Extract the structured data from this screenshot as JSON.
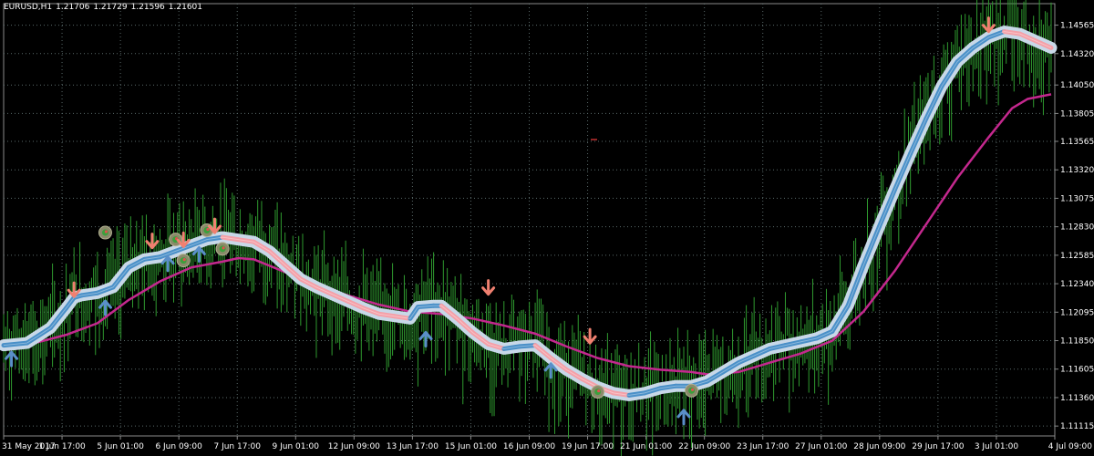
{
  "header": {
    "symbol": "EURUSD,H1",
    "open": "1.21706",
    "high": "1.21729",
    "low": "1.21596",
    "close": "1.21601"
  },
  "colors": {
    "background": "#000000",
    "grid": "#5a6a6a",
    "price_bars": "#2f9a2f",
    "slow_ma": "#c4288e",
    "band_outer": "#c8d8e8",
    "band_up": "#4a90c8",
    "band_down": "#f4a0a8",
    "arrow_up": "#5a8fc8",
    "arrow_down": "#f08070",
    "axis_text": "#ffffff"
  },
  "chart_data": {
    "type": "line",
    "title": "EURUSD,H1",
    "ylim": [
      1.1103,
      1.1475
    ],
    "y_ticks": [
      "1.14565",
      "1.14320",
      "1.14050",
      "1.13805",
      "1.13565",
      "1.13320",
      "1.13075",
      "1.12830",
      "1.12585",
      "1.12340",
      "1.12095",
      "1.11850",
      "1.11605",
      "1.11360",
      "1.11115"
    ],
    "x_ticks": [
      "31 May 2017",
      "1 Jun 17:00",
      "5 Jun 01:00",
      "6 Jun 09:00",
      "7 Jun 17:00",
      "9 Jun 01:00",
      "12 Jun 09:00",
      "13 Jun 17:00",
      "15 Jun 01:00",
      "16 Jun 09:00",
      "19 Jun 17:00",
      "21 Jun 01:00",
      "22 Jun 09:00",
      "23 Jun 17:00",
      "27 Jun 01:00",
      "28 Jun 09:00",
      "29 Jun 17:00",
      "3 Jul 01:00",
      "4 Jul 09:00"
    ],
    "grid": true,
    "series": [
      {
        "values": [
          [
            0,
            1.1181
          ],
          [
            3,
            1.1183
          ],
          [
            6,
            1.1196
          ],
          [
            8,
            1.1213
          ],
          [
            9,
            1.1222
          ],
          [
            10,
            1.1224
          ],
          [
            12,
            1.1226
          ],
          [
            14,
            1.1231
          ],
          [
            16,
            1.1248
          ],
          [
            18,
            1.1255
          ],
          [
            20,
            1.1257
          ],
          [
            22,
            1.1262
          ],
          [
            24,
            1.1267
          ],
          [
            26,
            1.1272
          ],
          [
            28,
            1.1274
          ],
          [
            30,
            1.1272
          ],
          [
            32,
            1.127
          ],
          [
            34,
            1.1262
          ],
          [
            36,
            1.125
          ],
          [
            38,
            1.1238
          ],
          [
            40,
            1.1231
          ],
          [
            42,
            1.1225
          ],
          [
            44,
            1.1219
          ],
          [
            46,
            1.1213
          ],
          [
            48,
            1.1208
          ],
          [
            50,
            1.1206
          ],
          [
            52,
            1.1204
          ],
          [
            53,
            1.1214
          ],
          [
            55,
            1.1215
          ],
          [
            56,
            1.1215
          ],
          [
            58,
            1.1204
          ],
          [
            60,
            1.1192
          ],
          [
            62,
            1.1182
          ],
          [
            64,
            1.1178
          ],
          [
            66,
            1.118
          ],
          [
            68,
            1.1181
          ],
          [
            70,
            1.117
          ],
          [
            72,
            1.116
          ],
          [
            74,
            1.1152
          ],
          [
            76,
            1.1145
          ],
          [
            78,
            1.114
          ],
          [
            80,
            1.1138
          ],
          [
            82,
            1.114
          ],
          [
            84,
            1.1144
          ],
          [
            86,
            1.1146
          ],
          [
            88,
            1.1146
          ],
          [
            90,
            1.115
          ],
          [
            92,
            1.1158
          ],
          [
            94,
            1.1166
          ],
          [
            96,
            1.1172
          ],
          [
            98,
            1.1178
          ],
          [
            100,
            1.1181
          ],
          [
            102,
            1.1184
          ],
          [
            104,
            1.1187
          ],
          [
            106,
            1.1193
          ],
          [
            108,
            1.1215
          ],
          [
            110,
            1.125
          ],
          [
            112,
            1.1283
          ],
          [
            114,
            1.1315
          ],
          [
            116,
            1.1346
          ],
          [
            118,
            1.1376
          ],
          [
            120,
            1.1404
          ],
          [
            122,
            1.1425
          ],
          [
            124,
            1.1437
          ],
          [
            126,
            1.1446
          ],
          [
            128,
            1.1451
          ],
          [
            130,
            1.1449
          ],
          [
            132,
            1.1443
          ],
          [
            134,
            1.1437
          ]
        ]
      },
      {
        "values": [
          [
            0,
            1.118
          ],
          [
            4,
            1.1183
          ],
          [
            8,
            1.119
          ],
          [
            12,
            1.12
          ],
          [
            16,
            1.122
          ],
          [
            20,
            1.1236
          ],
          [
            24,
            1.1248
          ],
          [
            28,
            1.1253
          ],
          [
            30,
            1.1256
          ],
          [
            32,
            1.1255
          ],
          [
            36,
            1.1244
          ],
          [
            40,
            1.1233
          ],
          [
            44,
            1.1224
          ],
          [
            48,
            1.1216
          ],
          [
            52,
            1.121
          ],
          [
            56,
            1.1208
          ],
          [
            60,
            1.1204
          ],
          [
            64,
            1.1198
          ],
          [
            68,
            1.1191
          ],
          [
            72,
            1.118
          ],
          [
            76,
            1.117
          ],
          [
            80,
            1.1163
          ],
          [
            84,
            1.116
          ],
          [
            88,
            1.1158
          ],
          [
            90,
            1.1156
          ],
          [
            94,
            1.1158
          ],
          [
            98,
            1.1166
          ],
          [
            102,
            1.1174
          ],
          [
            106,
            1.1185
          ],
          [
            110,
            1.121
          ],
          [
            114,
            1.1245
          ],
          [
            118,
            1.1285
          ],
          [
            122,
            1.1325
          ],
          [
            126,
            1.136
          ],
          [
            129,
            1.1385
          ],
          [
            131,
            1.1393
          ],
          [
            134,
            1.1397
          ]
        ]
      }
    ],
    "markers": [
      {
        "type": "arrow-up",
        "x": 1,
        "y": 1.1168
      },
      {
        "type": "arrow-down",
        "x": 9,
        "y": 1.123
      },
      {
        "type": "arrow-up",
        "x": 13,
        "y": 1.1212
      },
      {
        "type": "circle-marker",
        "x": 13,
        "y": 1.1278
      },
      {
        "type": "arrow-down",
        "x": 19,
        "y": 1.1272
      },
      {
        "type": "arrow-up",
        "x": 21,
        "y": 1.125
      },
      {
        "type": "circle-marker",
        "x": 22,
        "y": 1.1272
      },
      {
        "type": "arrow-down",
        "x": 23,
        "y": 1.1273
      },
      {
        "type": "circle-marker",
        "x": 23,
        "y": 1.1254
      },
      {
        "type": "arrow-up",
        "x": 25,
        "y": 1.1258
      },
      {
        "type": "circle-marker",
        "x": 26,
        "y": 1.128
      },
      {
        "type": "arrow-down",
        "x": 27,
        "y": 1.1285
      },
      {
        "type": "circle-marker",
        "x": 28,
        "y": 1.1264
      },
      {
        "type": "arrow-up",
        "x": 54,
        "y": 1.1185
      },
      {
        "type": "arrow-down",
        "x": 62,
        "y": 1.1232
      },
      {
        "type": "arrow-up",
        "x": 70,
        "y": 1.1158
      },
      {
        "type": "arrow-down",
        "x": 75,
        "y": 1.119
      },
      {
        "type": "circle-marker",
        "x": 76,
        "y": 1.1141
      },
      {
        "type": "circle-marker",
        "x": 88,
        "y": 1.1142
      },
      {
        "type": "arrow-up",
        "x": 87,
        "y": 1.1118
      },
      {
        "type": "arrow-down",
        "x": 126,
        "y": 1.1458
      }
    ]
  }
}
